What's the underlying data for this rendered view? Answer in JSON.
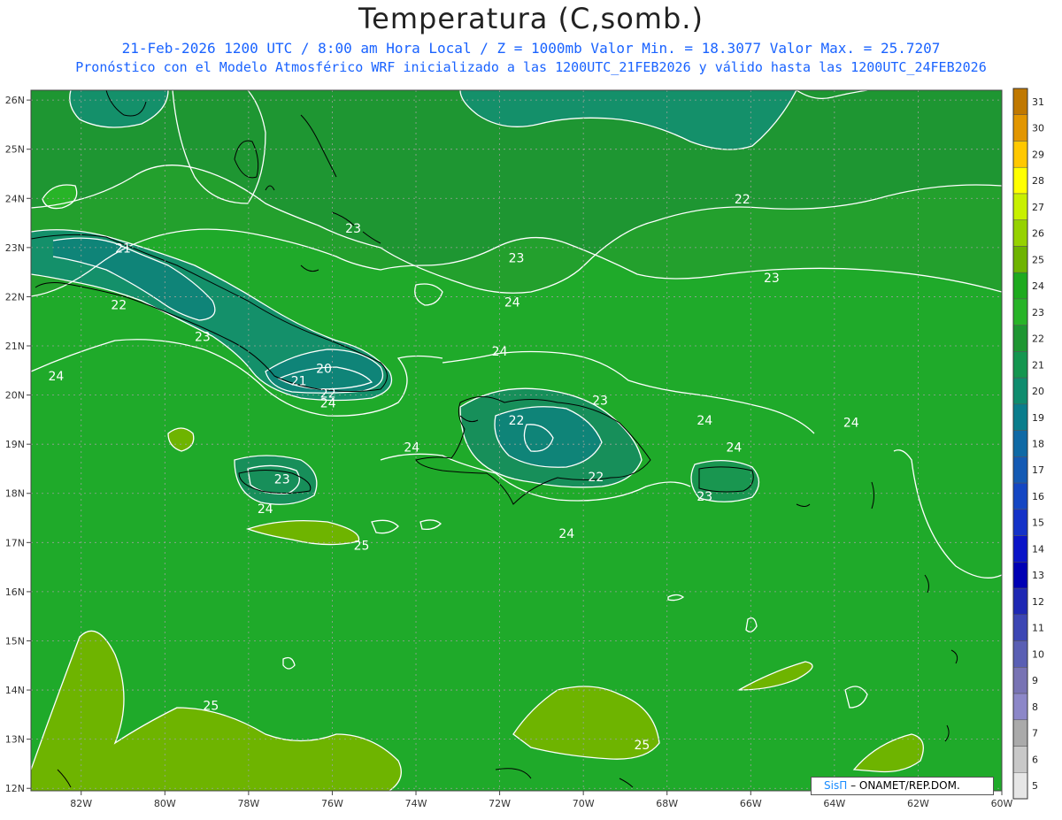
{
  "title": "Temperatura (C,somb.)",
  "subtitle_line1": "21-Feb-2026  1200 UTC / 8:00 am Hora Local / Z = 1000mb   Valor Min. = 18.3077  Valor Max. = 25.7207",
  "subtitle_line2": "Pronóstico con el Modelo Atmosférico WRF inicializado a las 1200UTC_21FEB2026 y válido hasta las  1200UTC_24FEB2026",
  "credit": {
    "brand": "SisΠ",
    "text": "– ONAMET/REP.DOM."
  },
  "map": {
    "lon_range": [
      -83.2,
      -60
    ],
    "lat_range": [
      11.95,
      26.2
    ],
    "lat_ticks": [
      "26N",
      "25N",
      "24N",
      "23N",
      "22N",
      "21N",
      "20N",
      "19N",
      "18N",
      "17N",
      "16N",
      "15N",
      "14N",
      "13N",
      "12N"
    ],
    "lon_ticks": [
      "82W",
      "80W",
      "78W",
      "76W",
      "74W",
      "72W",
      "70W",
      "68W",
      "66W",
      "64W",
      "62W",
      "60W"
    ],
    "grid": "dotted",
    "contour_labels": [
      {
        "text": "21",
        "lon": -81.0,
        "lat": 22.9
      },
      {
        "text": "22",
        "lon": -81.1,
        "lat": 21.75
      },
      {
        "text": "23",
        "lon": -79.1,
        "lat": 21.1
      },
      {
        "text": "24",
        "lon": -82.6,
        "lat": 20.3
      },
      {
        "text": "23",
        "lon": -75.5,
        "lat": 23.3
      },
      {
        "text": "20",
        "lon": -76.2,
        "lat": 20.45
      },
      {
        "text": "21",
        "lon": -76.8,
        "lat": 20.2
      },
      {
        "text": "22",
        "lon": -76.1,
        "lat": 19.95
      },
      {
        "text": "24",
        "lon": -76.1,
        "lat": 19.75
      },
      {
        "text": "23",
        "lon": -71.6,
        "lat": 22.7
      },
      {
        "text": "22",
        "lon": -66.2,
        "lat": 23.9
      },
      {
        "text": "23",
        "lon": -65.5,
        "lat": 22.3
      },
      {
        "text": "24",
        "lon": -71.7,
        "lat": 21.8
      },
      {
        "text": "24",
        "lon": -72.0,
        "lat": 20.8
      },
      {
        "text": "23",
        "lon": -69.6,
        "lat": 19.8
      },
      {
        "text": "22",
        "lon": -71.6,
        "lat": 19.4
      },
      {
        "text": "22",
        "lon": -69.7,
        "lat": 18.25
      },
      {
        "text": "24",
        "lon": -74.1,
        "lat": 18.85
      },
      {
        "text": "24",
        "lon": -67.1,
        "lat": 19.4
      },
      {
        "text": "24",
        "lon": -66.4,
        "lat": 18.85
      },
      {
        "text": "24",
        "lon": -63.6,
        "lat": 19.35
      },
      {
        "text": "23",
        "lon": -67.1,
        "lat": 17.85
      },
      {
        "text": "24",
        "lon": -70.4,
        "lat": 17.1
      },
      {
        "text": "23",
        "lon": -77.2,
        "lat": 18.2
      },
      {
        "text": "24",
        "lon": -77.6,
        "lat": 17.6
      },
      {
        "text": "25",
        "lon": -75.3,
        "lat": 16.85
      },
      {
        "text": "25",
        "lon": -78.9,
        "lat": 13.6
      },
      {
        "text": "25",
        "lon": -68.6,
        "lat": 12.8
      }
    ]
  },
  "colorbar": {
    "labels": [
      "31",
      "30",
      "29",
      "28",
      "27",
      "26",
      "25",
      "24",
      "23",
      "22",
      "21",
      "20",
      "19",
      "18",
      "17",
      "16",
      "15",
      "14",
      "13",
      "12",
      "11",
      "10",
      "9",
      "8",
      "7",
      "6",
      "5"
    ],
    "colors": [
      "#c07800",
      "#e29600",
      "#ffc800",
      "#ffff00",
      "#c8f000",
      "#96d200",
      "#6eb400",
      "#1eaa1e",
      "#28b428",
      "#1e9632",
      "#149650",
      "#0f8c6e",
      "#0a7d8c",
      "#0f69a5",
      "#145ab4",
      "#1446c3",
      "#1432c8",
      "#0a14c8",
      "#0000b4",
      "#1e28b4",
      "#3c46b4",
      "#5a5fb4",
      "#7873b4",
      "#8c87c8",
      "#aaaaaa",
      "#c8c8c8",
      "#e6e6e6"
    ]
  }
}
